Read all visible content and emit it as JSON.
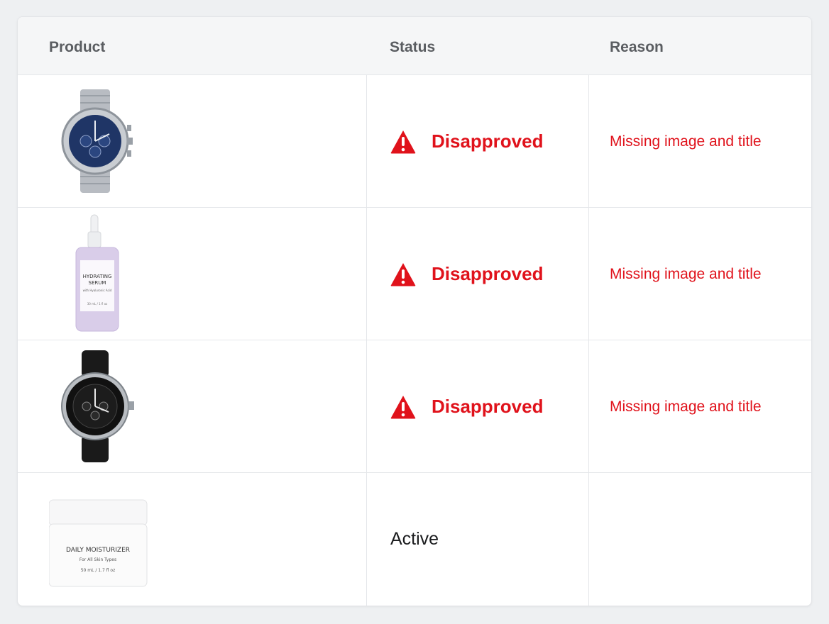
{
  "table": {
    "columns": [
      "Product",
      "Status",
      "Reason"
    ],
    "rows": [
      {
        "product_icon": "chronograph-watch-blue",
        "status": "Disapproved",
        "reason": "Missing image and title"
      },
      {
        "product_icon": "serum-bottle",
        "product_label": {
          "line1": "HYDRATING",
          "line2": "SERUM",
          "line3": "with Hyaluronic Acid",
          "line4": "30 mL / 1 fl oz"
        },
        "status": "Disapproved",
        "reason": "Missing image and title"
      },
      {
        "product_icon": "dive-watch-black",
        "status": "Disapproved",
        "reason": "Missing image and title"
      },
      {
        "product_icon": "moisturizer-jar",
        "product_label": {
          "line1": "DAILY MOISTURIZER",
          "line2": "For All Skin Types",
          "line3": "50 mL / 1.7 fl oz"
        },
        "status": "Active",
        "reason": ""
      }
    ]
  },
  "colors": {
    "error": "#e0121b",
    "header_bg": "#f5f6f7",
    "text": "#1b1c1e"
  }
}
